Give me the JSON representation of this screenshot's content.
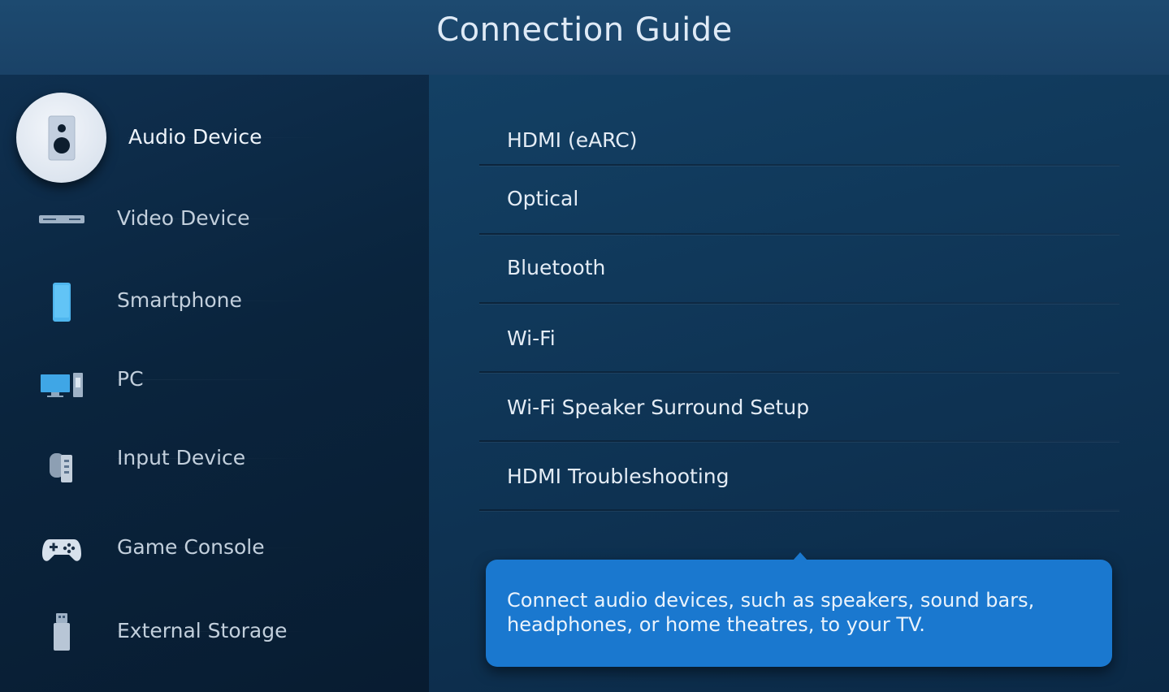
{
  "header": {
    "title": "Connection Guide"
  },
  "sidebar": {
    "items": [
      {
        "label": "Audio Device",
        "icon": "speaker-icon",
        "selected": true
      },
      {
        "label": "Video Device",
        "icon": "video-device-icon",
        "selected": false
      },
      {
        "label": "Smartphone",
        "icon": "smartphone-icon",
        "selected": false
      },
      {
        "label": "PC",
        "icon": "pc-icon",
        "selected": false
      },
      {
        "label": "Input Device",
        "icon": "input-device-icon",
        "selected": false
      },
      {
        "label": "Game Console",
        "icon": "gamepad-icon",
        "selected": false
      },
      {
        "label": "External Storage",
        "icon": "usb-storage-icon",
        "selected": false
      }
    ]
  },
  "options": {
    "items": [
      {
        "label": "HDMI (eARC)"
      },
      {
        "label": "Optical"
      },
      {
        "label": "Bluetooth"
      },
      {
        "label": "Wi-Fi"
      },
      {
        "label": "Wi-Fi Speaker Surround Setup"
      },
      {
        "label": "HDMI Troubleshooting"
      }
    ]
  },
  "tooltip": {
    "text": "Connect audio devices, such as speakers, sound bars, headphones, or home theatres, to your TV."
  },
  "colors": {
    "header_bg": "#1d4a70",
    "sidebar_bg": "#0a243d",
    "main_bg": "#0f3556",
    "accent": "#1a78cf",
    "text": "#e4ecf5"
  }
}
